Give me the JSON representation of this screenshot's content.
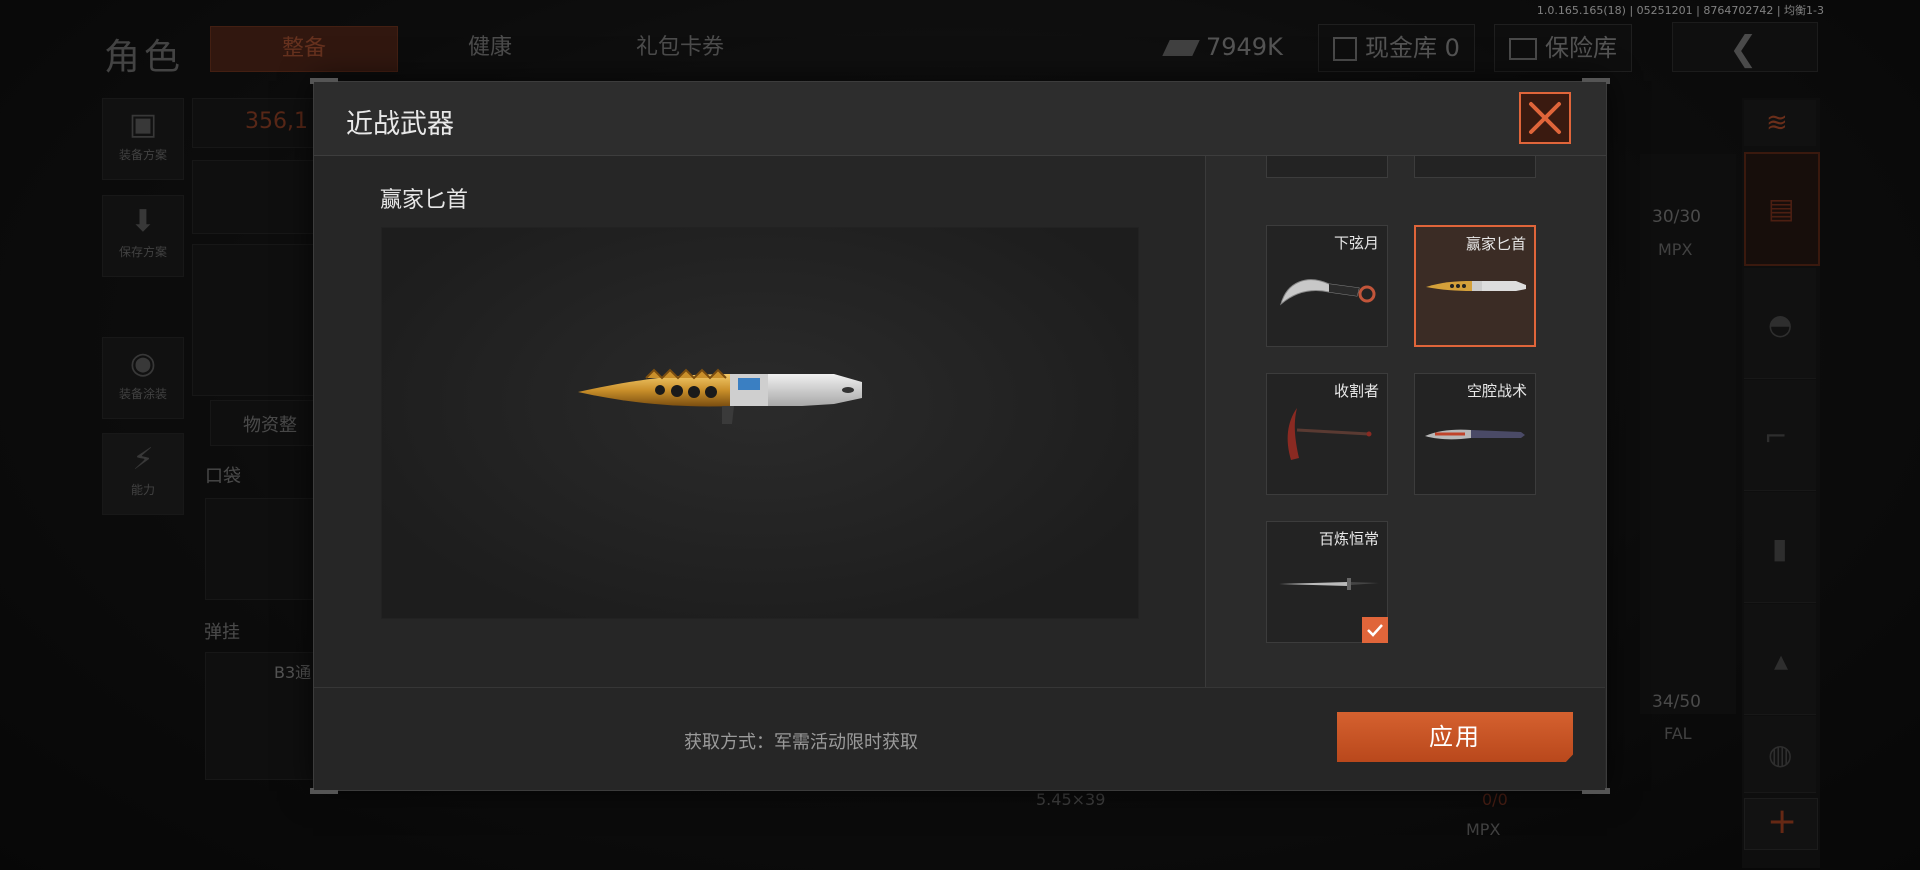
{
  "version": "1.0.165.165(18) | 05251201 | 8764702742 | 均衡1-3",
  "background": {
    "title": "角色",
    "tabs": [
      {
        "label": "整备"
      },
      {
        "label": "健康"
      },
      {
        "label": "礼包卡券"
      }
    ],
    "currency": "7949K",
    "cash_storage": "现金库 0",
    "safe_box": "保险库",
    "side_buttons": [
      {
        "label": "装备方案"
      },
      {
        "label": "保存方案"
      },
      {
        "label": "装备涂装"
      },
      {
        "label": "能力"
      }
    ],
    "value_partial": "356,1",
    "materials_partial": "物资整",
    "pocket_label": "口袋",
    "rig_label": "弹挂",
    "rig_item_partial": "B3通",
    "ammo1": "30/30",
    "gun1": "MPX",
    "ammo2": "34/50",
    "gun2": "FAL",
    "caliber": "5.45×39",
    "ammo3": "0/0",
    "gun3": "MPX"
  },
  "modal": {
    "title": "近战武器",
    "selected_name": "赢家匕首",
    "obtain_method": "获取方式：军需活动限时获取",
    "apply_label": "应用",
    "items": [
      {
        "name": "下弦月",
        "icon": "karambit-icon",
        "selected": false,
        "equipped": false
      },
      {
        "name": "赢家匕首",
        "icon": "gold-dagger-icon",
        "selected": true,
        "equipped": false
      },
      {
        "name": "收割者",
        "icon": "sickle-icon",
        "selected": false,
        "equipped": false
      },
      {
        "name": "空腔战术",
        "icon": "tactical-knife-icon",
        "selected": false,
        "equipped": false
      },
      {
        "name": "百炼恒常",
        "icon": "sword-icon",
        "selected": false,
        "equipped": true
      }
    ]
  },
  "colors": {
    "accent": "#e0653a",
    "panel": "#2a2a2a"
  }
}
